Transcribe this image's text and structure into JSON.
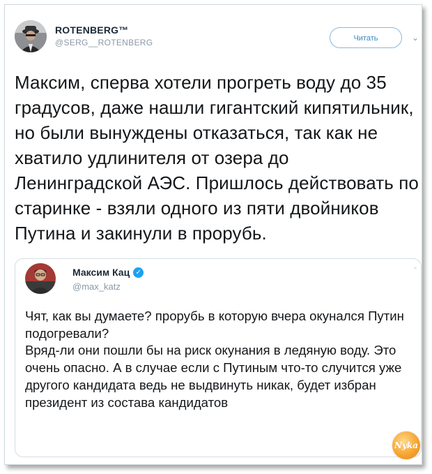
{
  "tweet": {
    "author_name": "ROTENBERG™",
    "author_handle": "@SERG__ROTENBERG",
    "follow_label": "Читать",
    "more_icon": "chevron-down-icon",
    "text": "Максим, сперва хотели прогреть воду до 35 градусов, даже нашли гигантский кипятильник, но были вынуждены отказаться, так как не хватило удлинителя от озера до Ленинградской АЭС. Пришлось действовать по старинке - взяли одного из пяти двойников Путина и закинули в прорубь."
  },
  "quoted_tweet": {
    "author_name": "Максим Кац",
    "verified": true,
    "author_handle": "@max_katz",
    "text": "Чят, как вы думаете? прорубь в которую вчера окунался Путин подогревали?\nВряд-ли они пошли бы на риск окунания в ледяную воду. Это очень опасно. А в случае если с Путиным что-то случится уже другого кандидата ведь не выдвинуть никак, будет избран президент из состава кандидатов"
  },
  "watermark": {
    "label": "Nyka"
  },
  "colors": {
    "accent": "#1da1f2",
    "follow_text": "#3b88c3",
    "text": "#14171a",
    "muted": "#8a99a6",
    "watermark": "#f5a12a"
  }
}
